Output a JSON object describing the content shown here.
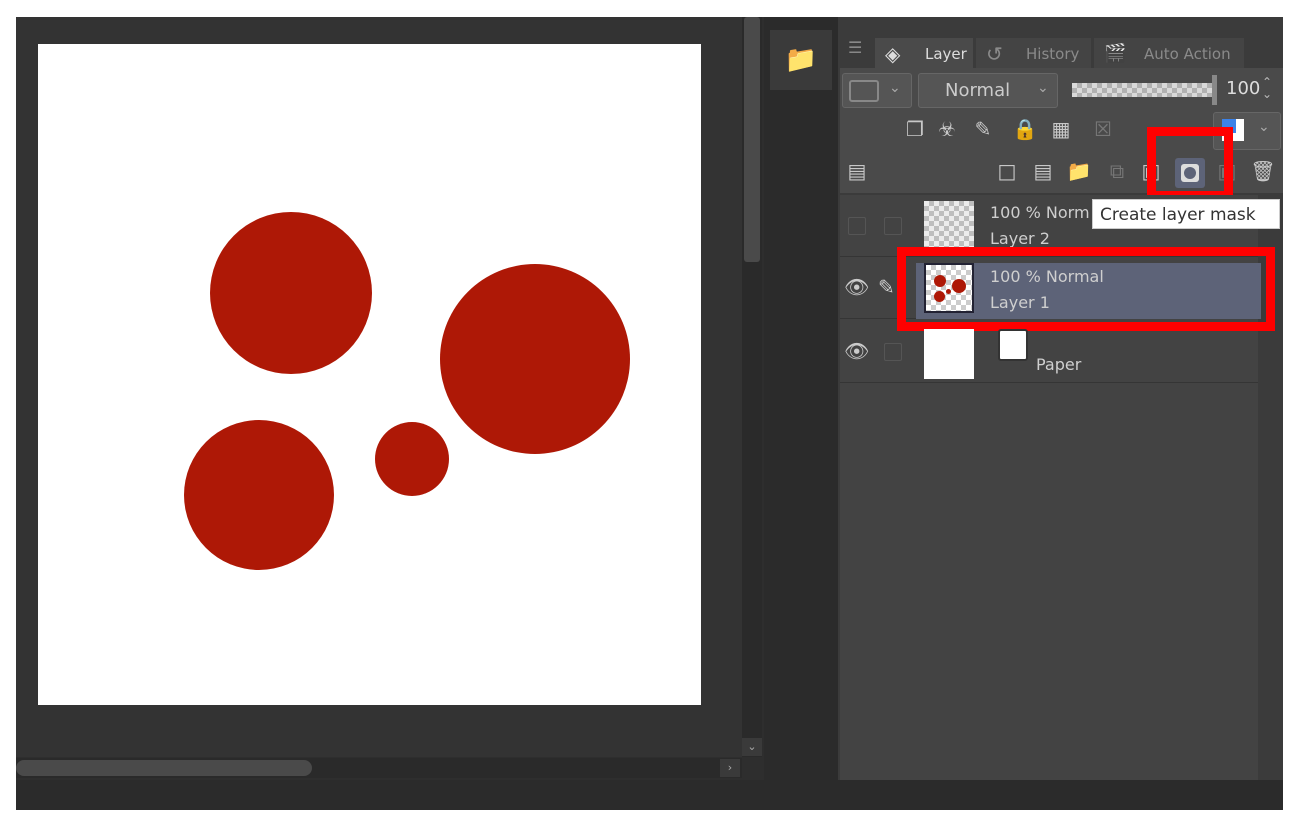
{
  "panel": {
    "tabs": [
      {
        "label": "Layer",
        "icon": "layers-icon"
      },
      {
        "label": "History",
        "icon": "history-icon"
      },
      {
        "label": "Auto Action",
        "icon": "clapper-icon"
      }
    ],
    "blend_mode": "Normal",
    "opacity": "100",
    "opacity_fraction": 1.0
  },
  "layers": [
    {
      "info": "100 % Norm",
      "name": "Layer 2",
      "visible": false
    },
    {
      "info": "100 % Normal",
      "name": "Layer 1",
      "visible": true,
      "selected": true
    },
    {
      "info": "",
      "name": "Paper",
      "visible": true
    }
  ],
  "tooltip": "Create layer mask",
  "colors": {
    "accent_highlight": "#ff0000",
    "circle": "#ae1806",
    "selected_row": "#5d6378"
  }
}
